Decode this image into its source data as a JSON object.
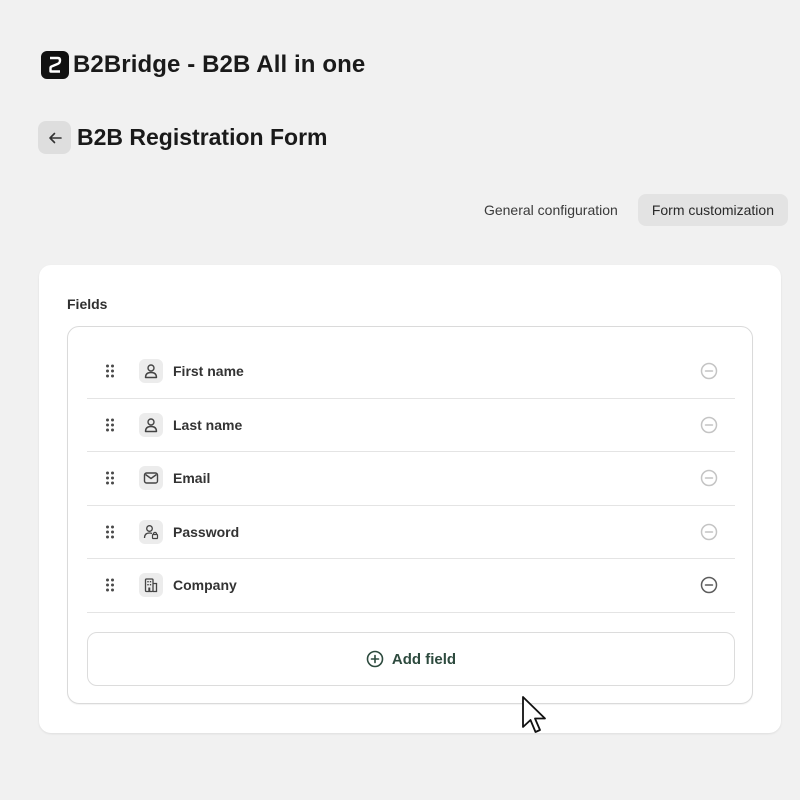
{
  "app": {
    "title": "B2Bridge - B2B All in one",
    "logo_icon": "b2bridge-logo-icon"
  },
  "page": {
    "title": "B2B Registration Form",
    "back_icon": "arrow-left-icon"
  },
  "tabs": [
    {
      "label": "General configuration",
      "active": false
    },
    {
      "label": "Form customization",
      "active": true
    }
  ],
  "card": {
    "title": "Fields",
    "fields": [
      {
        "label": "First name",
        "icon": "person-icon",
        "remove_enabled": false
      },
      {
        "label": "Last name",
        "icon": "person-icon",
        "remove_enabled": false
      },
      {
        "label": "Email",
        "icon": "envelope-icon",
        "remove_enabled": false
      },
      {
        "label": "Password",
        "icon": "person-lock-icon",
        "remove_enabled": false
      },
      {
        "label": "Company",
        "icon": "building-icon",
        "remove_enabled": true
      }
    ],
    "add_button": {
      "label": "Add field",
      "icon": "plus-circle-icon"
    }
  },
  "colors": {
    "accent_green": "#2d4a3e",
    "remove_disabled": "#c4c4c4",
    "remove_enabled": "#5c5c5c"
  }
}
